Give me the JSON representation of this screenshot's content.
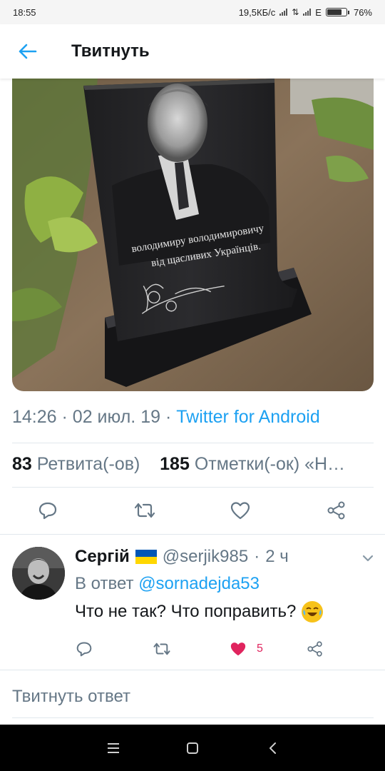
{
  "status_bar": {
    "time": "18:55",
    "network_speed": "19,5КБ/с",
    "network_type": "E",
    "battery_percent": "76%",
    "battery_level": 0.76
  },
  "header": {
    "title": "Твитнуть"
  },
  "tweet": {
    "image_inscription_line1": "володимиру володимировичу",
    "image_inscription_line2": "від щасливих Українців.",
    "time": "14:26",
    "date": "02 июл. 19",
    "source": "Twitter for Android",
    "retweets_count": "83",
    "retweets_label": "Ретвита(-ов)",
    "likes_count": "185",
    "likes_label": "Отметки(-ок) «Н…"
  },
  "reply": {
    "name": "Сергій",
    "handle": "@serjik985",
    "age": "2 ч",
    "in_reply_label": "В ответ",
    "in_reply_handle": "@sornadejda53",
    "text": "Что не так? Что поправить?",
    "like_count": "5"
  },
  "compose": {
    "placeholder": "Твитнуть ответ"
  },
  "colors": {
    "accent": "#1da1f2",
    "secondary_text": "#657786",
    "like": "#e0245e",
    "flag_blue": "#0057b7",
    "flag_yellow": "#ffd700"
  },
  "icons": [
    "back-arrow-icon",
    "reply-icon",
    "retweet-icon",
    "like-icon",
    "share-icon",
    "chevron-down-icon",
    "menu-icon",
    "home-icon",
    "back-icon"
  ]
}
